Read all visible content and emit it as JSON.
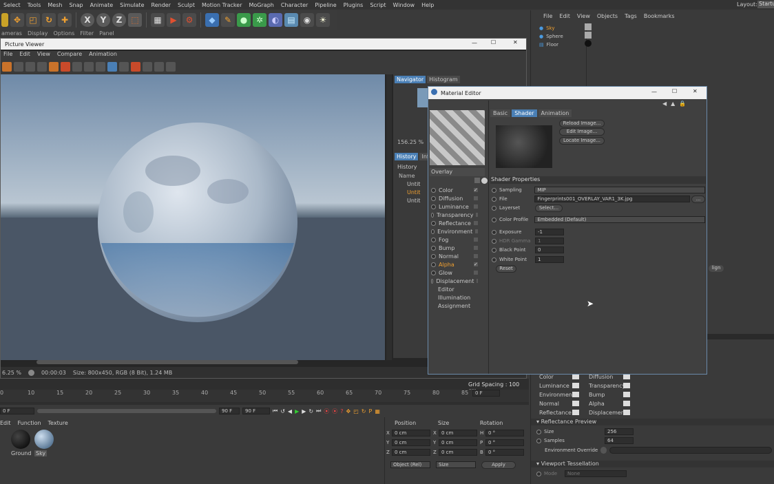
{
  "menubar": {
    "items": [
      "Select",
      "Tools",
      "Mesh",
      "Snap",
      "Animate",
      "Simulate",
      "Render",
      "Sculpt",
      "Motion Tracker",
      "MoGraph",
      "Character",
      "Pipeline",
      "Plugins",
      "Script",
      "Window",
      "Help"
    ],
    "layout_label": "Layout:",
    "layout_value": "Startu"
  },
  "submenu": [
    "ameras",
    "Display",
    "Options",
    "Filter",
    "Panel"
  ],
  "picture_viewer": {
    "title": "Picture Viewer",
    "menu": [
      "File",
      "Edit",
      "View",
      "Compare",
      "Animation"
    ],
    "tabs": [
      "Navigator",
      "Histogram"
    ],
    "zoom": "156.25 %",
    "history_tabs": [
      "History",
      "Info"
    ],
    "history_label": "History",
    "name_header": "Name",
    "history_items": [
      "Untit",
      "Untit",
      "Untit"
    ],
    "status_zoom": "6.25 %",
    "status_time": "00:00:03",
    "status_size": "Size: 800x450, RGB (8 Bit), 1.24 MB"
  },
  "material_editor": {
    "title": "Material Editor",
    "preview_label": "Overlay",
    "channels": [
      {
        "label": "Color",
        "checked": "✓"
      },
      {
        "label": "Diffusion",
        "checked": ""
      },
      {
        "label": "Luminance",
        "checked": ""
      },
      {
        "label": "Transparency",
        "checked": ""
      },
      {
        "label": "Reflectance",
        "checked": ""
      },
      {
        "label": "Environment",
        "checked": ""
      },
      {
        "label": "Fog",
        "checked": ""
      },
      {
        "label": "Bump",
        "checked": ""
      },
      {
        "label": "Normal",
        "checked": ""
      },
      {
        "label": "Alpha",
        "checked": "✓"
      },
      {
        "label": "Glow",
        "checked": ""
      },
      {
        "label": "Displacement",
        "checked": ""
      }
    ],
    "extras": [
      "Editor",
      "Illumination",
      "Assignment"
    ],
    "tabs": [
      "Basic",
      "Shader",
      "Animation"
    ],
    "buttons": [
      "Reload Image...",
      "Edit Image...",
      "Locate Image..."
    ],
    "shader_properties": "Shader Properties",
    "sampling_label": "Sampling",
    "sampling_value": "MIP",
    "file_label": "File",
    "file_value": "Fingerprints001_OVERLAY_VAR1_3K.jpg",
    "file_btn": "...",
    "layerset_label": "Layerset",
    "layerset_btn": "Select...",
    "color_profile_label": "Color Profile",
    "color_profile_value": "Embedded (Default)",
    "exposure_label": "Exposure",
    "exposure_value": "-1",
    "hdr_label": "HDR Gamma",
    "hdr_value": "1",
    "black_label": "Black Point",
    "black_value": "0",
    "white_label": "White Point",
    "white_value": "1",
    "reset_btn": "Reset"
  },
  "object_manager": {
    "menu": [
      "File",
      "Edit",
      "View",
      "Objects",
      "Tags",
      "Bookmarks"
    ],
    "objects": [
      "Sky",
      "Sphere",
      "Floor"
    ]
  },
  "attributes": {
    "grid_spacing": "Grid Spacing : 100 cm",
    "left_channels": [
      "Color",
      "Luminance",
      "Environment",
      "Normal",
      "Reflectance"
    ],
    "right_channels": [
      "Diffusion",
      "Transparency",
      "Bump",
      "Alpha",
      "Displacement"
    ],
    "reflectance_preview": "Reflectance Preview",
    "size_label": "Size",
    "size_value": "256",
    "samples_label": "Samples",
    "samples_value": "64",
    "env_override": "Environment Override",
    "viewport_tess": "Viewport Tessellation",
    "mode_label": "Mode",
    "mode_value": "None",
    "align_btn": "lign"
  },
  "timeline": {
    "ticks": [
      "0",
      "10",
      "15",
      "20",
      "25",
      "30",
      "35",
      "40",
      "45",
      "50",
      "55",
      "60",
      "65",
      "70",
      "75",
      "80",
      "85",
      "90"
    ],
    "frame_end": "0 F",
    "start": "0 F",
    "end_a": "90 F",
    "end_b": "90 F"
  },
  "material_bar": {
    "menu": [
      "Edit",
      "Function",
      "Texture"
    ],
    "materials": [
      "Ground",
      "Sky"
    ]
  },
  "coordinates": {
    "headers": [
      "Position",
      "Size",
      "Rotation"
    ],
    "rows": [
      {
        "axis": "X",
        "pos": "0 cm",
        "size_axis": "X",
        "size": "0 cm",
        "rot_axis": "H",
        "rot": "0 °"
      },
      {
        "axis": "Y",
        "pos": "0 cm",
        "size_axis": "Y",
        "size": "0 cm",
        "rot_axis": "P",
        "rot": "0 °"
      },
      {
        "axis": "Z",
        "pos": "0 cm",
        "size_axis": "Z",
        "size": "0 cm",
        "rot_axis": "B",
        "rot": "0 °"
      }
    ],
    "mode": "Object (Rel)",
    "size_mode": "Size",
    "apply": "Apply"
  },
  "colors": {
    "accent": "#4a7fb5",
    "highlight": "#f0a030",
    "bg": "#3a3a3a"
  }
}
